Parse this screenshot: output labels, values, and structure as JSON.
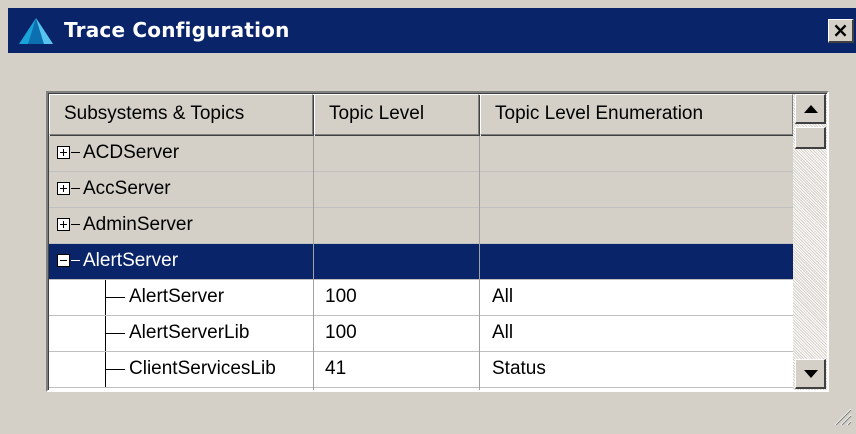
{
  "window": {
    "title": "Trace Configuration",
    "close_label": "×"
  },
  "grid": {
    "columns": [
      "Subsystems & Topics",
      "Topic Level",
      "Topic Level Enumeration"
    ],
    "rows": [
      {
        "type": "group",
        "expander": "plus",
        "name": "ACDServer",
        "level": "",
        "enumeration": ""
      },
      {
        "type": "group",
        "expander": "plus",
        "name": "AccServer",
        "level": "",
        "enumeration": ""
      },
      {
        "type": "group",
        "expander": "plus",
        "name": "AdminServer",
        "level": "",
        "enumeration": ""
      },
      {
        "type": "group",
        "expander": "minus",
        "name": "AlertServer",
        "level": "",
        "enumeration": "",
        "selected": true
      },
      {
        "type": "child",
        "name": "AlertServer",
        "level": "100",
        "enumeration": "All"
      },
      {
        "type": "child",
        "name": "AlertServerLib",
        "level": "100",
        "enumeration": "All"
      },
      {
        "type": "child",
        "name": "ClientServicesLib",
        "level": "41",
        "enumeration": "Status"
      }
    ]
  },
  "scrollbar": {
    "up_icon": "arrow-up-icon",
    "down_icon": "arrow-down-icon",
    "position": 0
  },
  "colors": {
    "titlebar": "#0a246a",
    "selection": "#0a246a",
    "face": "#d4d0c8"
  }
}
